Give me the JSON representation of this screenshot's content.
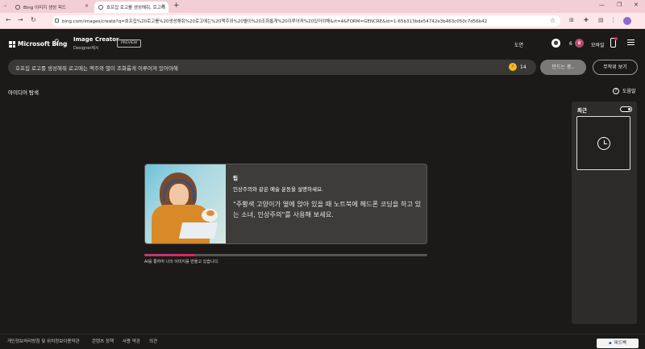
{
  "browser": {
    "tabs": [
      {
        "label": "Bing 이미지 생성 피드"
      },
      {
        "label": "호프집 로고를 생성해줘, 로고에"
      }
    ],
    "url": "bing.com/images/create?q=호프집%20로고를%20생성해줘%20로고에는%20맥주와%20별이%20조화롭게%20이루어져%20있어야해&rt=4&FORM=GENCRE&id=1-65b313bde54742e3b463c050c7d56b42"
  },
  "header": {
    "brand": "Microsoft Bing",
    "product_title": "Image Creator",
    "product_sub": "Designer제시",
    "preview_badge": "PREVIEW",
    "login_label": "도연",
    "points": "6",
    "mobile_label": "모바일"
  },
  "prompt": {
    "text": "호프집 로고를 생성해줘 로고에는 맥주와 별이 조화롭게 이루어져 있어야해",
    "boost_count": "14",
    "create_label": "만드는 중..",
    "surprise_label": "무작위 보기"
  },
  "explore": {
    "label": "아이디어 탐색"
  },
  "help": {
    "label": "도움말"
  },
  "tip": {
    "title": "팁",
    "subtitle": "인상주의와 같은 예술 운동을 설명하세요.",
    "body": "\"주황색 고양이가 옆에 앉아 있을 때 노트북에 헤드폰 코딩을 하고 있는 소녀, 인상주의\"를 사용해 보세요."
  },
  "progress": {
    "fraction": 0.18,
    "status": "AI를 통하여 나의 이미지를 만들고 있습니다."
  },
  "recent": {
    "title": "최근"
  },
  "footer": {
    "links": [
      "개인정보처리방침 및 위치정보이용약관",
      "콘텐츠 정책",
      "사용 약관",
      "의견"
    ],
    "feedback_label": "피드백"
  },
  "colors": {
    "accent": "#e0245e",
    "panel": "#2d2c2b",
    "background": "#1b1a19"
  }
}
